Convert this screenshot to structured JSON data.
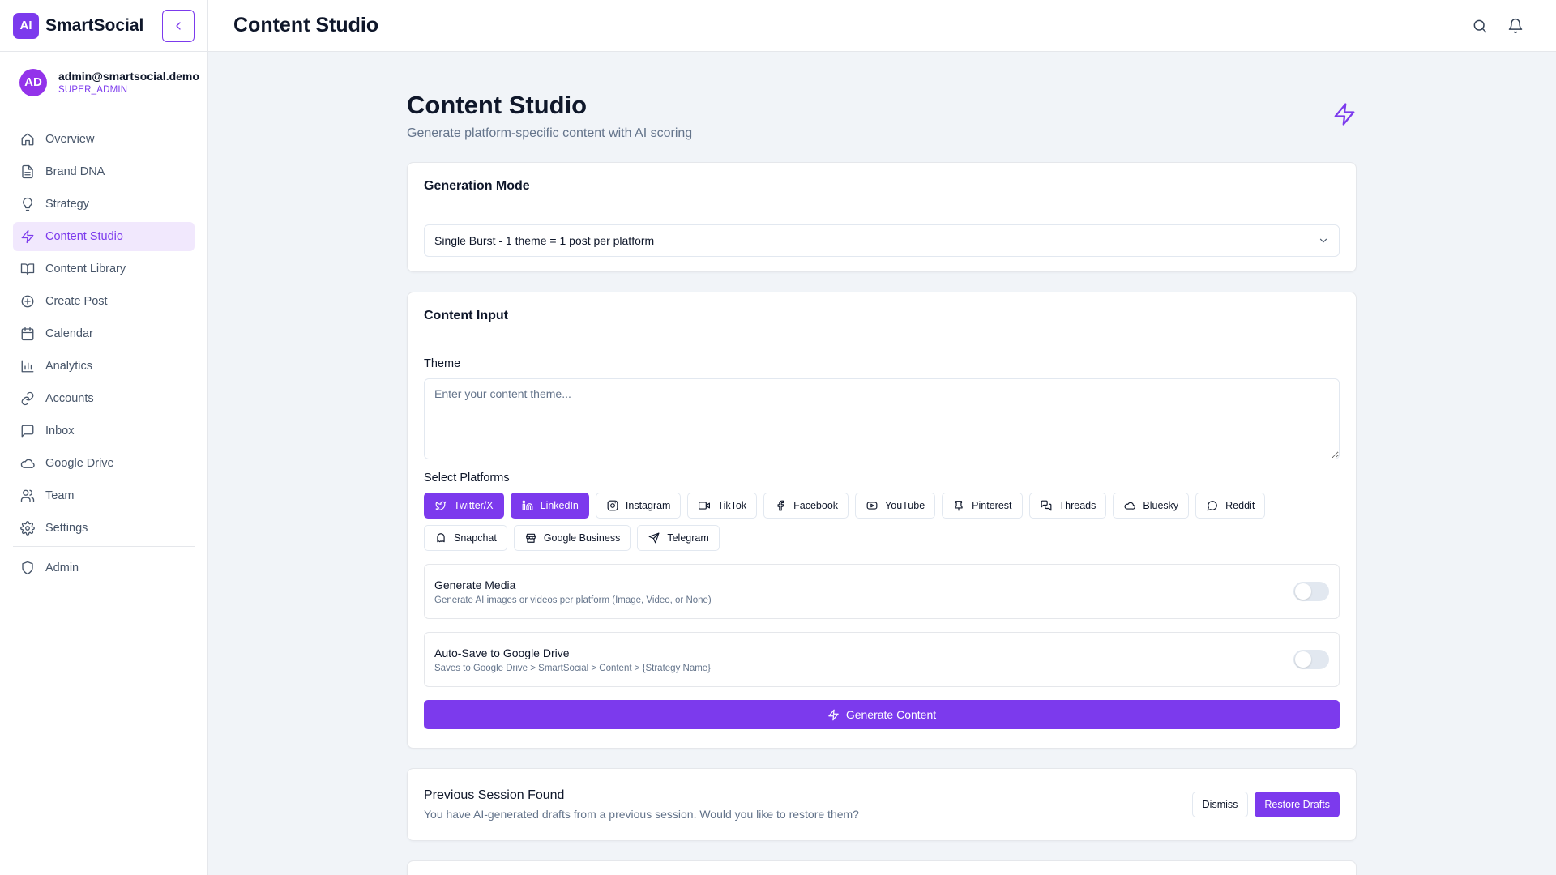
{
  "brand": {
    "logo": "AI",
    "name": "SmartSocial"
  },
  "user": {
    "initials": "AD",
    "email": "admin@smartsocial.demo",
    "role": "SUPER_ADMIN"
  },
  "sidebar": {
    "items": [
      {
        "label": "Overview",
        "icon": "home-icon"
      },
      {
        "label": "Brand DNA",
        "icon": "document-icon"
      },
      {
        "label": "Strategy",
        "icon": "lightbulb-icon"
      },
      {
        "label": "Content Studio",
        "icon": "bolt-icon",
        "active": true
      },
      {
        "label": "Content Library",
        "icon": "book-icon"
      },
      {
        "label": "Create Post",
        "icon": "plus-circle-icon"
      },
      {
        "label": "Calendar",
        "icon": "calendar-icon"
      },
      {
        "label": "Analytics",
        "icon": "bar-chart-icon"
      },
      {
        "label": "Accounts",
        "icon": "link-icon"
      },
      {
        "label": "Inbox",
        "icon": "message-icon"
      },
      {
        "label": "Google Drive",
        "icon": "cloud-icon"
      },
      {
        "label": "Team",
        "icon": "users-icon"
      },
      {
        "label": "Settings",
        "icon": "gear-icon"
      }
    ],
    "admin": {
      "label": "Admin",
      "icon": "shield-icon"
    }
  },
  "topbar": {
    "title": "Content Studio"
  },
  "page": {
    "title": "Content Studio",
    "subtitle": "Generate platform-specific content with AI scoring"
  },
  "generation_mode": {
    "title": "Generation Mode",
    "selected": "Single Burst - 1 theme = 1 post per platform"
  },
  "content_input": {
    "title": "Content Input",
    "theme_label": "Theme",
    "theme_placeholder": "Enter your content theme...",
    "platforms_label": "Select Platforms",
    "platforms": [
      {
        "label": "Twitter/X",
        "icon": "twitter-icon",
        "selected": true
      },
      {
        "label": "LinkedIn",
        "icon": "linkedin-icon",
        "selected": true
      },
      {
        "label": "Instagram",
        "icon": "instagram-icon",
        "selected": false
      },
      {
        "label": "TikTok",
        "icon": "video-icon",
        "selected": false
      },
      {
        "label": "Facebook",
        "icon": "facebook-icon",
        "selected": false
      },
      {
        "label": "YouTube",
        "icon": "youtube-icon",
        "selected": false
      },
      {
        "label": "Pinterest",
        "icon": "pin-icon",
        "selected": false
      },
      {
        "label": "Threads",
        "icon": "threads-icon",
        "selected": false
      },
      {
        "label": "Bluesky",
        "icon": "cloud-icon",
        "selected": false
      },
      {
        "label": "Reddit",
        "icon": "chat-bubble-icon",
        "selected": false
      },
      {
        "label": "Snapchat",
        "icon": "ghost-icon",
        "selected": false
      },
      {
        "label": "Google Business",
        "icon": "store-icon",
        "selected": false
      },
      {
        "label": "Telegram",
        "icon": "send-icon",
        "selected": false
      }
    ],
    "generate_media": {
      "title": "Generate Media",
      "desc": "Generate AI images or videos per platform (Image, Video, or None)"
    },
    "auto_save": {
      "title": "Auto-Save to Google Drive",
      "desc": "Saves to Google Drive > SmartSocial > Content > {Strategy Name}"
    },
    "generate_button": "Generate Content"
  },
  "previous_session": {
    "title": "Previous Session Found",
    "desc": "You have AI-generated drafts from a previous session. Would you like to restore them?",
    "dismiss": "Dismiss",
    "restore": "Restore Drafts"
  },
  "colors": {
    "accent": "#7c3aed",
    "accent_light": "#f1e8fd",
    "background": "#f1f4f8"
  }
}
